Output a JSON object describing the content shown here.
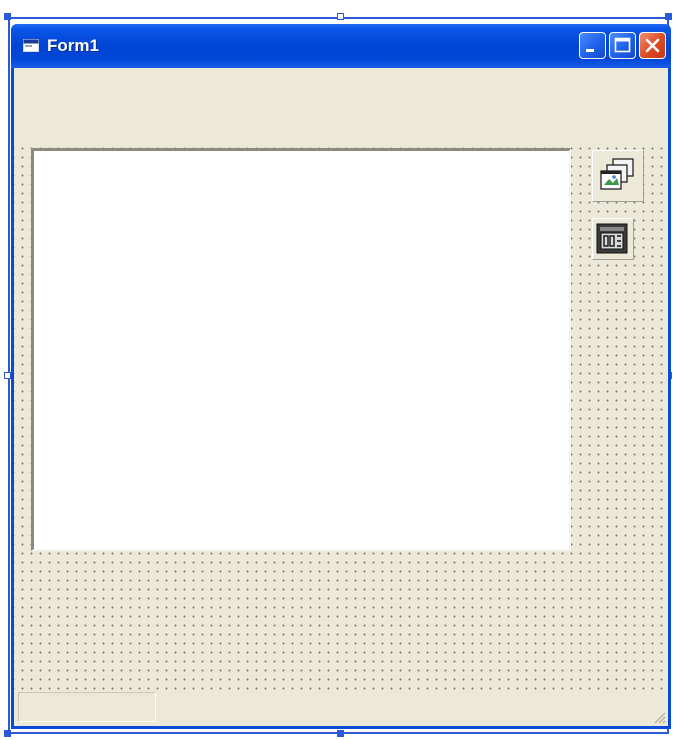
{
  "window": {
    "title": "Form1",
    "icon": "form-app-icon",
    "buttons": [
      "minimize-icon",
      "maximize-icon",
      "close-icon"
    ]
  },
  "form": {
    "grid": true,
    "list_box": {
      "icon": "list-box-control"
    },
    "controls": [
      {
        "icon": "image-list-icon"
      },
      {
        "icon": "timer-control-icon"
      }
    ],
    "status_bar": {
      "panels": 1
    }
  },
  "colors": {
    "title_bar": "#0145d6",
    "window_border": "#0a4bd6",
    "face": "#ece9d8",
    "close_button": "#dd4a23",
    "selection": "#2a5ad8"
  }
}
